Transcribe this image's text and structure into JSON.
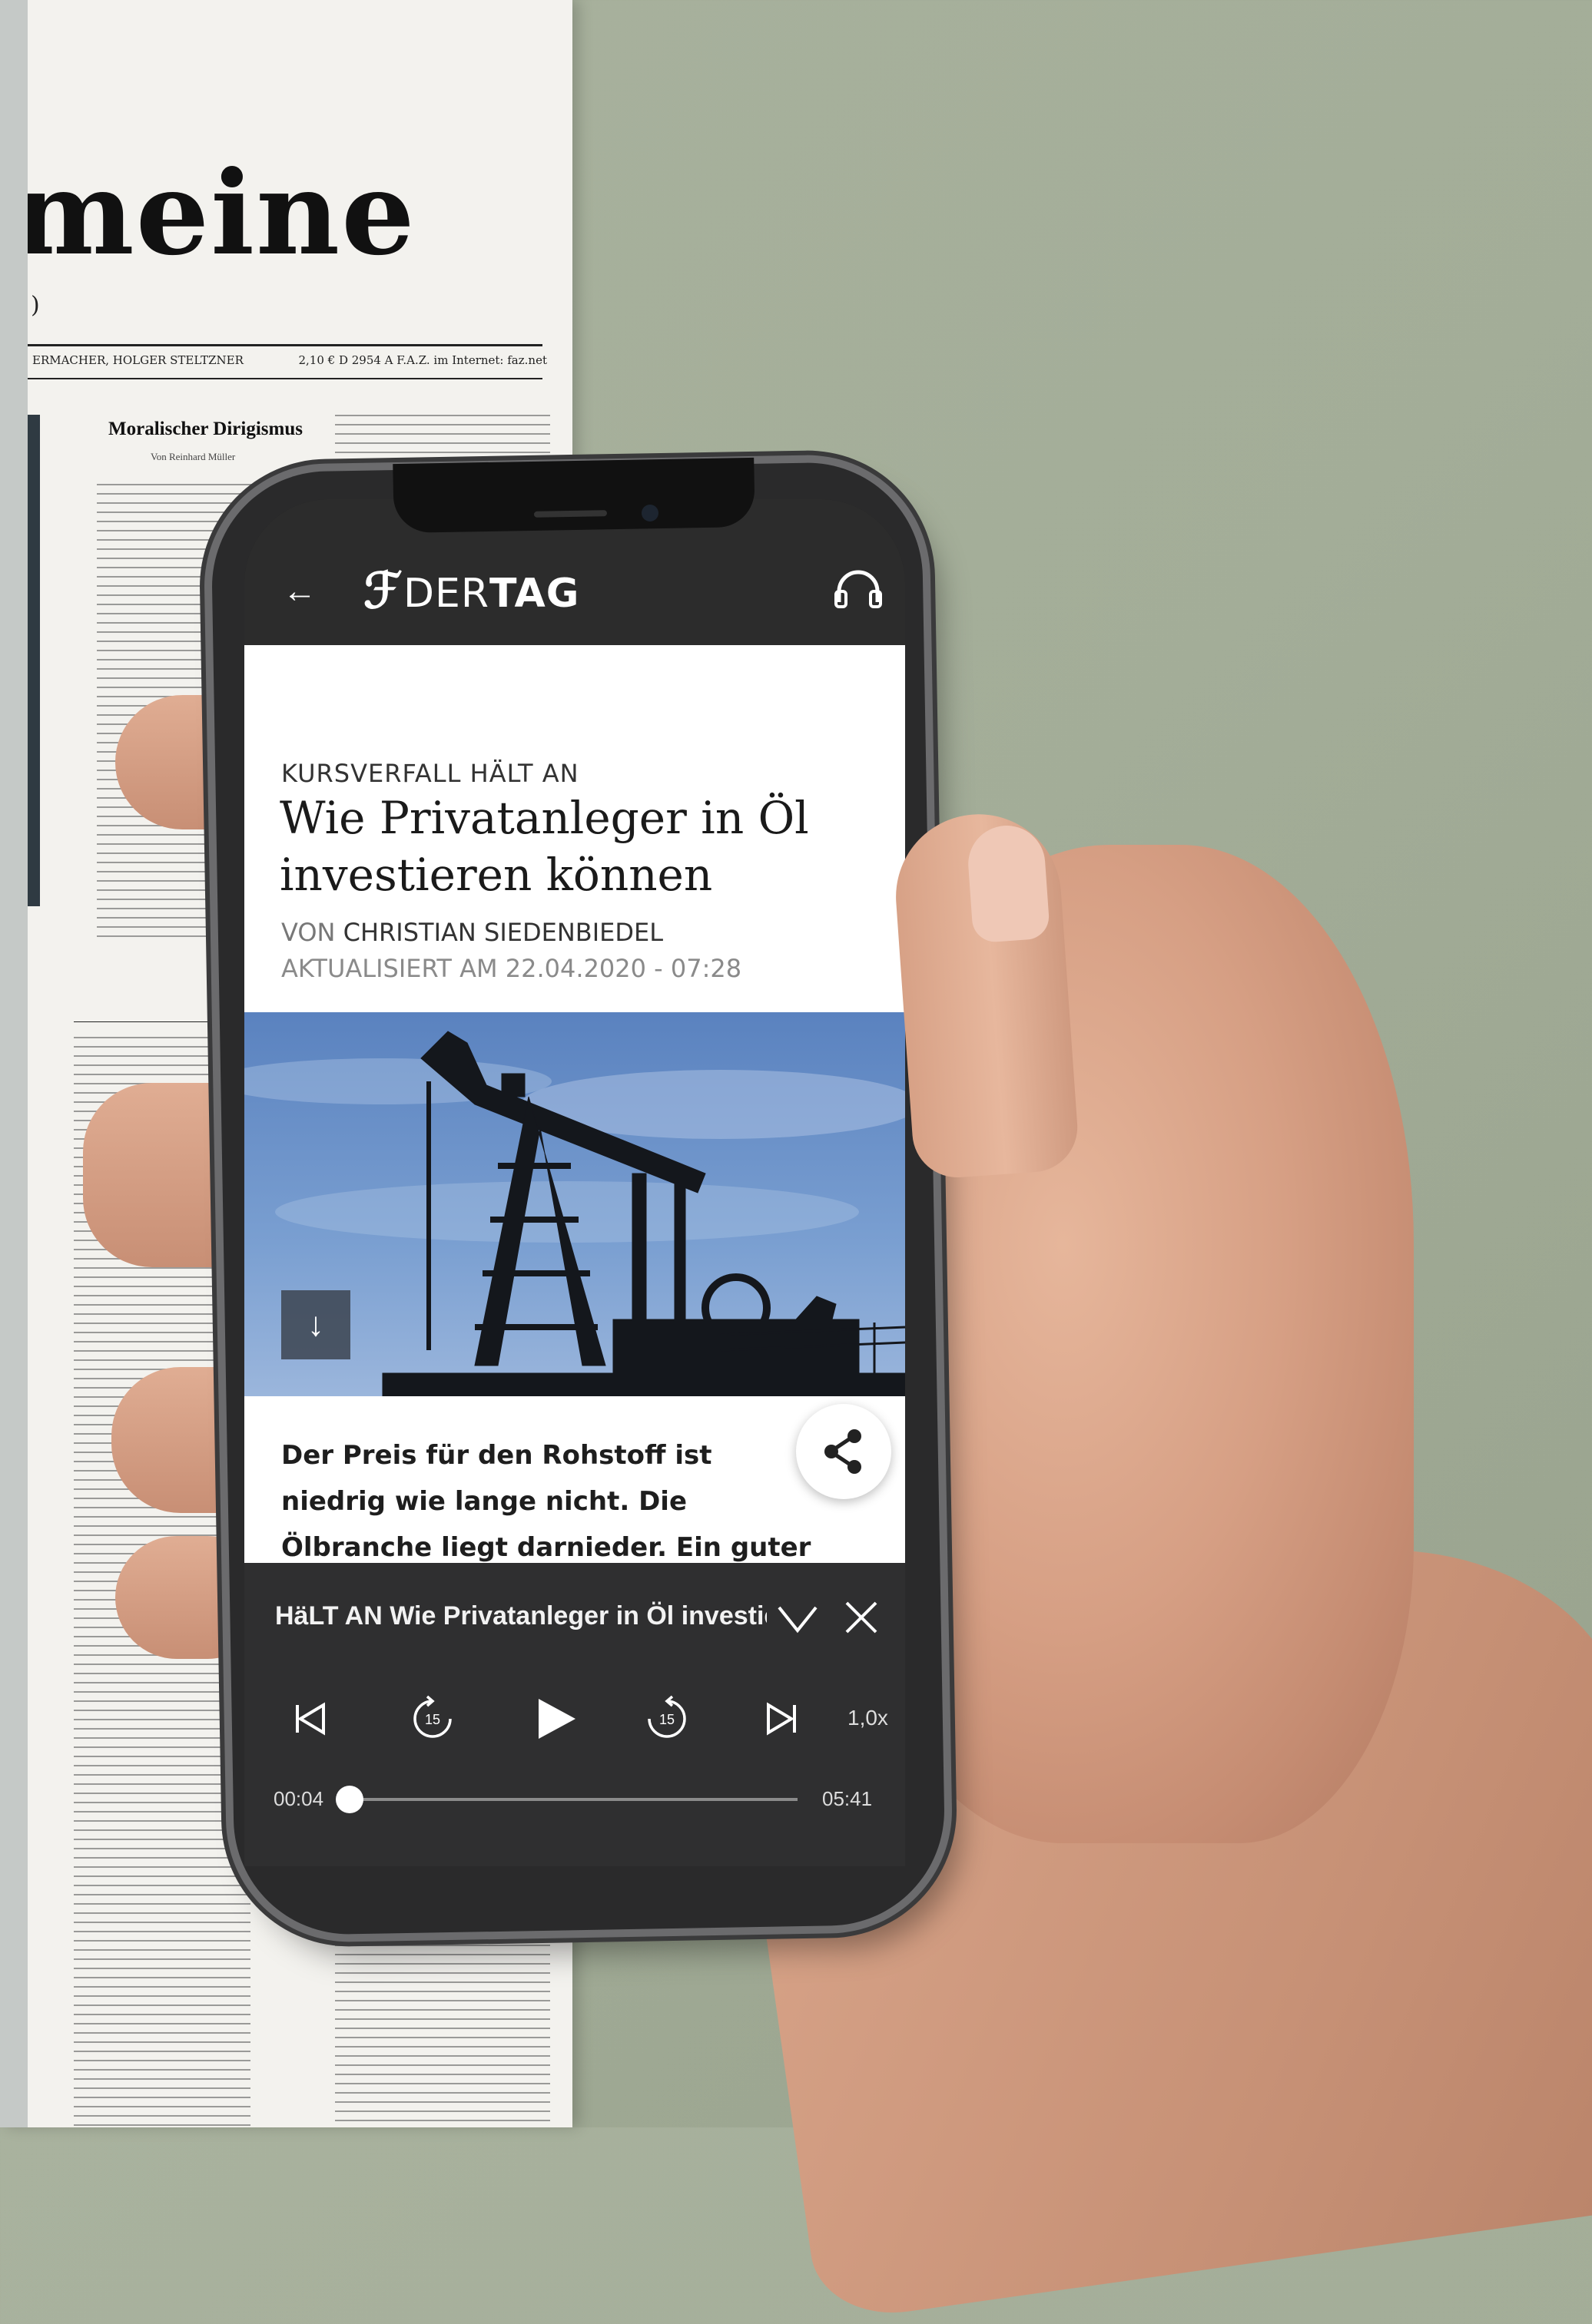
{
  "newspaper": {
    "masthead": "meine",
    "subline": ")",
    "meta_left": "ERMACHER, HOLGER STELTZNER",
    "meta_right": "2,10 € D 2954 A   F.A.Z. im Internet: faz.net",
    "headline": "Moralischer Dirigismus",
    "byline": "Von Reinhard Müller"
  },
  "appbar": {
    "back_icon": "arrow-left-icon",
    "brand_mark": "ℱ",
    "brand_prefix": "DER",
    "brand_suffix": "TAG",
    "headphones_icon": "headphones-icon"
  },
  "article": {
    "kicker": "KURSVERFALL HÄLT AN",
    "headline": "Wie Privatanleger in Öl investieren können",
    "byline_prefix": "VON",
    "author": "CHRISTIAN SIEDENBIEDEL",
    "updated": "AKTUALISIERT AM 22.04.2020 - 07:28",
    "download_icon": "↓",
    "teaser": "Der Preis für den Rohstoff ist niedrig wie lange nicht. Die Ölbranche liegt darnieder. Ein guter Zeitpunkt für Anleger, um einzusteigen?",
    "share_icon": "share-icon"
  },
  "player": {
    "title": "HäLT AN   Wie Privatanleger in Öl investieren können",
    "speed": "1,0x",
    "elapsed": "00:04",
    "duration": "05:41",
    "progress": 0.012,
    "rewind_label": "15",
    "forward_label": "15"
  },
  "colors": {
    "background": "#a5ae99",
    "appbar": "#2c2c2c",
    "player": "#2f2f30",
    "sky": "#6f93c8"
  }
}
